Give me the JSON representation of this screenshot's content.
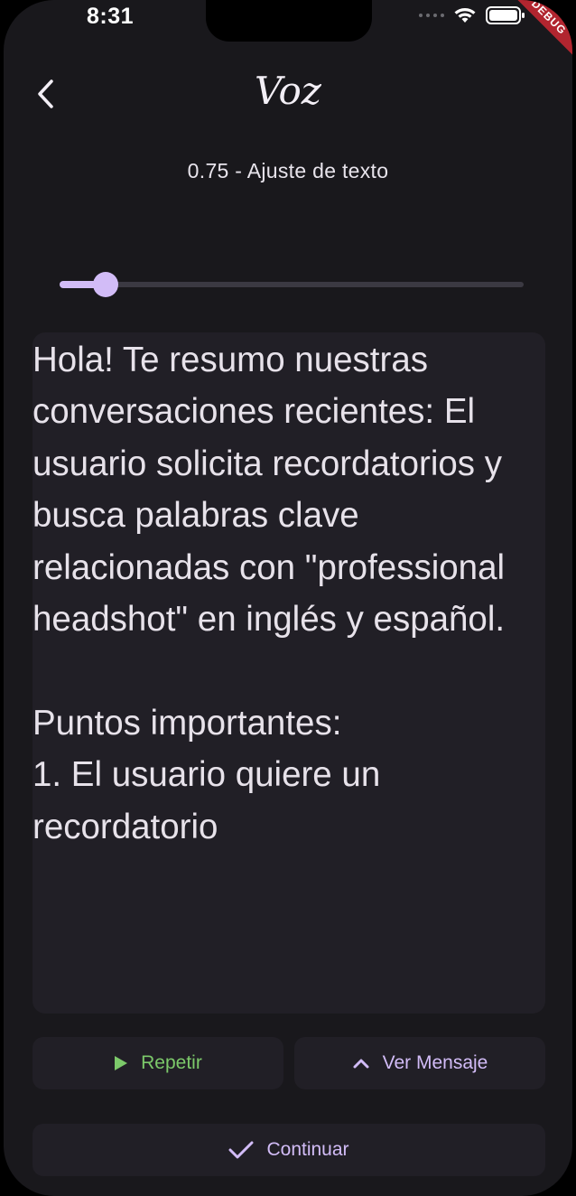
{
  "status_bar": {
    "time": "8:31",
    "debug_label": "DEBUG"
  },
  "header": {
    "back_icon": "chevron-left-icon",
    "title": "Voz",
    "speed_label": "0.75 - Ajuste de texto"
  },
  "speed_slider": {
    "value": 0.75,
    "fill_fraction": 0.1,
    "color": "#d2bcf7"
  },
  "message": {
    "text": "Hola! Te resumo nuestras conversaciones recientes: El usuario solicita recordatorios y busca palabras clave relacionadas con \"professional headshot\" en inglés y español.\n\nPuntos importantes:\n1. El usuario quiere un recordatorio"
  },
  "buttons": {
    "repeat_label": "Repetir",
    "repeat_icon": "play-icon",
    "view_message_label": "Ver Mensaje",
    "view_message_icon": "chevron-up-icon",
    "continue_label": "Continuar",
    "continue_icon": "check-icon"
  },
  "colors": {
    "background": "#19181c",
    "surface": "#211f26",
    "accent": "#d2bcf7",
    "repeat_green": "#7cc96a"
  }
}
